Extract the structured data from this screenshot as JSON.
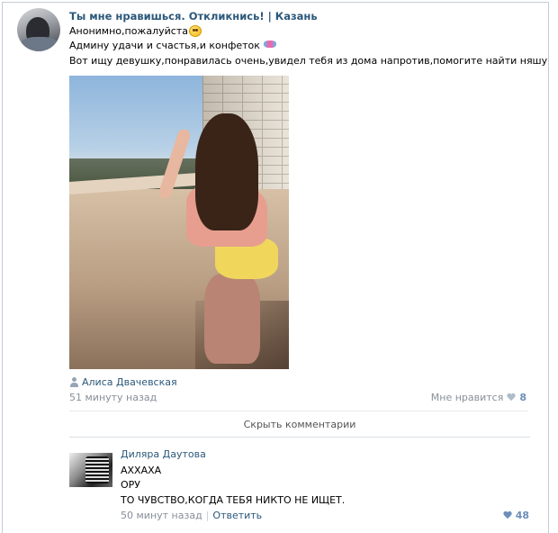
{
  "post": {
    "title": "Ты мне нравишься. Откликнись! | Казань",
    "lines": [
      "Анонимно,пожалуйста",
      "Админу удачи и счастья,и конфеток",
      "Вот ищу девушку,понравилась очень,увидел тебя из дома напротив,помогите найти няшу"
    ],
    "emoji_1": "smiley-face-icon",
    "emoji_2": "candy-icon",
    "author": "Алиса Двачевская",
    "time": "51 минуту назад",
    "like_label": "Мне нравится",
    "like_count": "8"
  },
  "hide_comments": "Скрыть комментарии",
  "comment": {
    "author": "Диляра Даутова",
    "lines": [
      "АХХАХА",
      "ОРУ",
      "ТО ЧУВСТВО,КОГДА ТЕБЯ НИКТО НЕ ИЩЕТ."
    ],
    "time": "50 минут назад",
    "reply": "Ответить",
    "like_count": "48"
  },
  "colors": {
    "link": "#2b587a",
    "meta": "#888f99",
    "like_active": "#6d8eb8"
  }
}
